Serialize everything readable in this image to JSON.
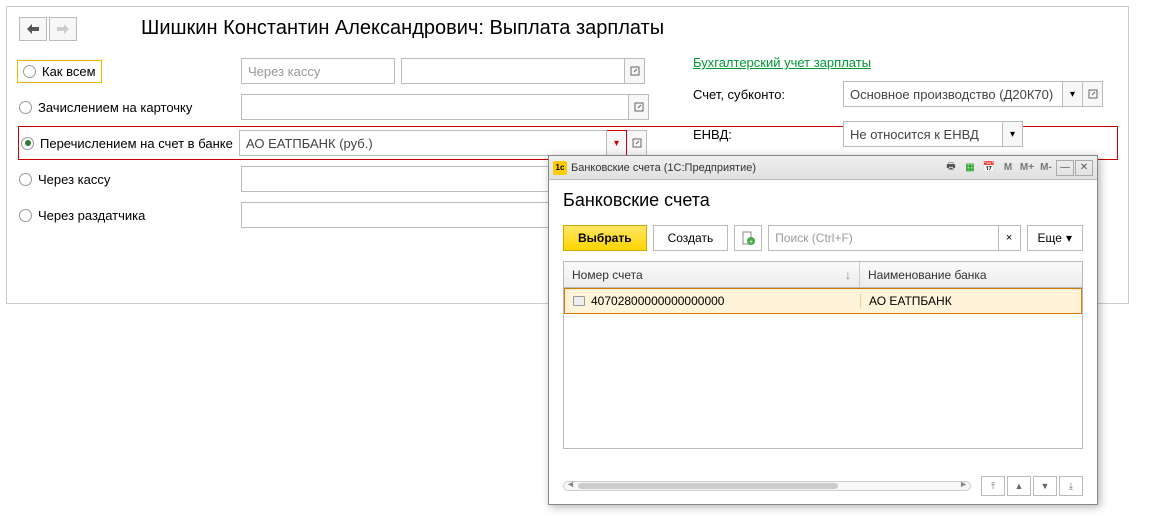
{
  "header": {
    "title": "Шишкин Константин Александрович: Выплата зарплаты"
  },
  "payment_methods": {
    "r0": {
      "label": "Как всем"
    },
    "r1": {
      "label": "Зачислением на карточку"
    },
    "r2": {
      "label": "Перечислением на счет в банке"
    },
    "r3": {
      "label": "Через кассу"
    },
    "r4": {
      "label": "Через раздатчика"
    }
  },
  "fields": {
    "row0_placeholder": "Через кассу",
    "row2_value": "АО ЕАТПБАНК (руб.)"
  },
  "right": {
    "link": "Бухгалтерский учет зарплаты",
    "account_label": "Счет, субконто:",
    "account_value": "Основное производство (Д20К70)",
    "envd_label": "ЕНВД:",
    "envd_value": "Не относится к ЕНВД"
  },
  "dialog": {
    "titlebar": "Банковские счета  (1С:Предприятие)",
    "heading": "Банковские счета",
    "btn_select": "Выбрать",
    "btn_create": "Создать",
    "search_placeholder": "Поиск (Ctrl+F)",
    "btn_more": "Еще",
    "columns": {
      "c0": "Номер счета",
      "c1": "Наименование банка"
    },
    "rows": [
      {
        "account": "40702800000000000000",
        "bank": "АО ЕАТПБАНК"
      }
    ],
    "m1": "M",
    "m2": "M+",
    "m3": "M-"
  }
}
